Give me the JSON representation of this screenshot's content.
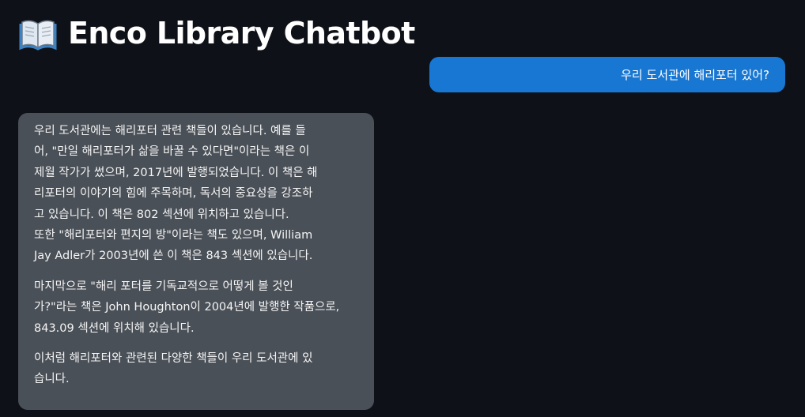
{
  "header": {
    "icon": "open-book-icon",
    "title": "Enco Library Chatbot"
  },
  "chat": {
    "user_message": "우리 도서관에 해리포터 있어?",
    "assistant_message": {
      "paragraph_1_line_1": "우리 도서관에는 해리포터 관련 책들이 있습니다. 예를 들",
      "paragraph_1_line_2": "어, \"만일 해리포터가 삶을 바꿀 수 있다면\"이라는 책은 이",
      "paragraph_1_line_3": "제월 작가가 썼으며, 2017년에 발행되었습니다. 이 책은 해",
      "paragraph_1_line_4": "리포터의 이야기의 힘에 주목하며, 독서의 중요성을 강조하",
      "paragraph_1_line_5": "고 있습니다. 이 책은 802 섹션에 위치하고 있습니다.",
      "paragraph_1_line_6": "또한 \"해리포터와 편지의 방\"이라는 책도 있으며, William",
      "paragraph_1_line_7": "Jay Adler가 2003년에 쓴 이 책은 843 섹션에 있습니다.",
      "paragraph_2_line_1": "마지막으로 \"해리 포터를 기독교적으로 어떻게 볼 것인",
      "paragraph_2_line_2": "가?\"라는 책은 John Houghton이 2004년에 발행한 작품으로,",
      "paragraph_2_line_3": "843.09 섹션에 위치해 있습니다.",
      "paragraph_3_line_1": "이처럼 해리포터와 관련된 다양한 책들이 우리 도서관에 있",
      "paragraph_3_line_2": "습니다."
    }
  },
  "colors": {
    "background": "#0e1117",
    "user_bubble": "#1877d2",
    "assistant_bubble": "#4a5058",
    "text": "#fafafa"
  }
}
